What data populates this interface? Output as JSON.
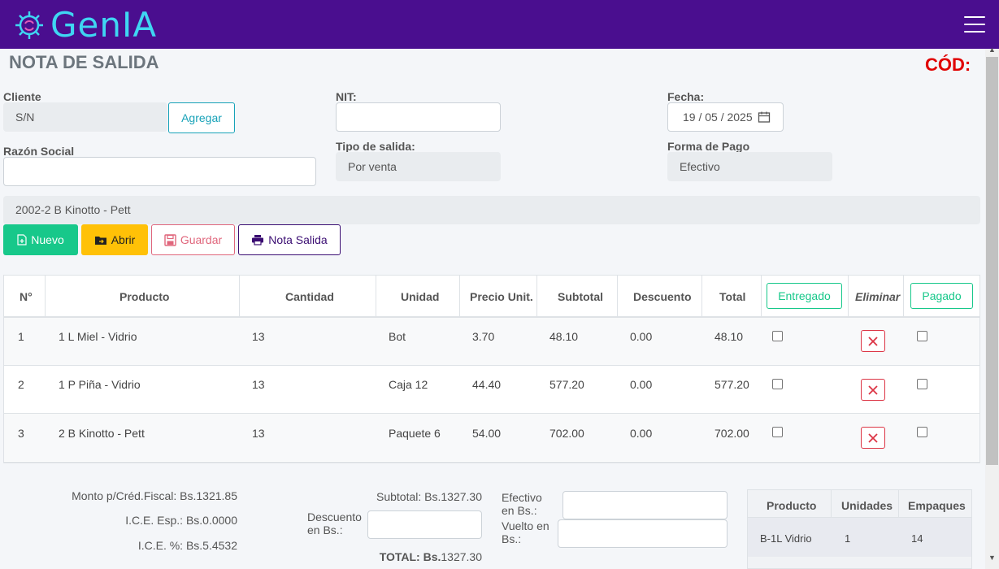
{
  "app": {
    "brand": "GenIA"
  },
  "page": {
    "title": "NOTA DE SALIDA",
    "code_label": "CÓD:"
  },
  "form": {
    "cliente_label": "Cliente",
    "cliente_value": "S/N",
    "agregar_label": "Agregar",
    "nit_label": "NIT:",
    "nit_value": "",
    "fecha_label": "Fecha:",
    "fecha_value": "19 / 05 / 2025",
    "razon_label": "Razón Social",
    "razon_value": "",
    "tipo_label": "Tipo de salida:",
    "tipo_value": "Por venta",
    "pago_label": "Forma de Pago",
    "pago_value": "Efectivo",
    "product_select": "2002-2 B Kinotto - Pett"
  },
  "actions": {
    "nuevo": "Nuevo",
    "abrir": "Abrir",
    "guardar": "Guardar",
    "nota": "Nota Salida"
  },
  "table": {
    "headers": {
      "num": "N°",
      "producto": "Producto",
      "cantidad": "Cantidad",
      "unidad": "Unidad",
      "precio": "Precio Unit.",
      "subtotal": "Subtotal",
      "descuento": "Descuento",
      "total": "Total",
      "entregado": "Entregado",
      "eliminar": "Eliminar",
      "pagado": "Pagado"
    },
    "rows": [
      {
        "num": "1",
        "producto": "1 L Miel - Vidrio",
        "cantidad": "13",
        "unidad": "Bot",
        "precio": "3.70",
        "subtotal": "48.10",
        "descuento": "0.00",
        "total": "48.10"
      },
      {
        "num": "2",
        "producto": "1 P Piña - Vidrio",
        "cantidad": "13",
        "unidad": "Caja 12",
        "precio": "44.40",
        "subtotal": "577.20",
        "descuento": "0.00",
        "total": "577.20"
      },
      {
        "num": "3",
        "producto": "2 B Kinotto - Pett",
        "cantidad": "13",
        "unidad": "Paquete 6",
        "precio": "54.00",
        "subtotal": "702.00",
        "descuento": "0.00",
        "total": "702.00"
      }
    ]
  },
  "summary": {
    "monto": "Monto p/Créd.Fiscal: Bs.1321.85",
    "ice_esp": "I.C.E. Esp.: Bs.0.0000",
    "ice_pct": "I.C.E. %: Bs.5.4532",
    "subtotal": "Subtotal: Bs.1327.30",
    "descuento_l1": "Descuento",
    "descuento_l2": "en Bs.:",
    "total_label": "TOTAL: Bs.",
    "total_value": "1327.30",
    "efectivo_l1": "Efectivo",
    "efectivo_l2": "en Bs.:",
    "vuelto_l1": "Vuelto en",
    "vuelto_l2": "Bs.:"
  },
  "mini_table": {
    "headers": {
      "producto": "Producto",
      "unidades": "Unidades",
      "empaques": "Empaques"
    },
    "rows": [
      {
        "producto": "B-1L Vidrio",
        "unidades": "1",
        "empaques": "14"
      }
    ]
  },
  "colors": {
    "topbar": "#4a0e8f",
    "brand": "#3fd6f2",
    "cod": "#e00000"
  }
}
